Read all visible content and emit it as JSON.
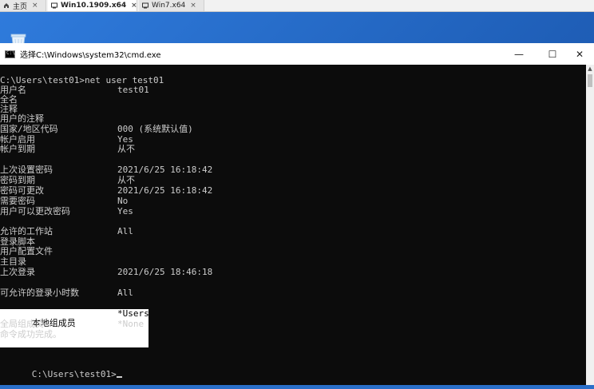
{
  "tabs": [
    {
      "label": "主页",
      "icon": "home-icon"
    },
    {
      "label": "Win10.1909.x64",
      "icon": "vm-icon"
    },
    {
      "label": "Win7.x64",
      "icon": "vm-icon"
    }
  ],
  "tab_close": "×",
  "desktop": {
    "recycle_icon": "recycle-bin-icon"
  },
  "window": {
    "title": "选择C:\\Windows\\system32\\cmd.exe",
    "minimize": "—",
    "maximize": "☐",
    "close": "✕"
  },
  "console": {
    "command_line": "C:\\Users\\test01>net user test01",
    "rows": [
      {
        "label": "用户名",
        "value": "test01"
      },
      {
        "label": "全名",
        "value": ""
      },
      {
        "label": "注释",
        "value": ""
      },
      {
        "label": "用户的注释",
        "value": ""
      },
      {
        "label": "国家/地区代码",
        "value": "000 (系统默认值)"
      },
      {
        "label": "帐户启用",
        "value": "Yes"
      },
      {
        "label": "帐户到期",
        "value": "从不"
      },
      {
        "label": "",
        "value": ""
      },
      {
        "label": "上次设置密码",
        "value": "2021/6/25 16:18:42"
      },
      {
        "label": "密码到期",
        "value": "从不"
      },
      {
        "label": "密码可更改",
        "value": "2021/6/25 16:18:42"
      },
      {
        "label": "需要密码",
        "value": "No"
      },
      {
        "label": "用户可以更改密码",
        "value": "Yes"
      },
      {
        "label": "",
        "value": ""
      },
      {
        "label": "允许的工作站",
        "value": "All"
      },
      {
        "label": "登录脚本",
        "value": ""
      },
      {
        "label": "用户配置文件",
        "value": ""
      },
      {
        "label": "主目录",
        "value": ""
      },
      {
        "label": "上次登录",
        "value": "2021/6/25 18:46:18"
      },
      {
        "label": "",
        "value": ""
      },
      {
        "label": "可允许的登录小时数",
        "value": "All"
      },
      {
        "label": "",
        "value": ""
      },
      {
        "label": "本地组成员",
        "value": "*Users"
      },
      {
        "label": "全局组成员",
        "value": "*None"
      },
      {
        "label": "命令成功完成。",
        "value": ""
      }
    ],
    "prompt": "C:\\Users\\test01>"
  }
}
